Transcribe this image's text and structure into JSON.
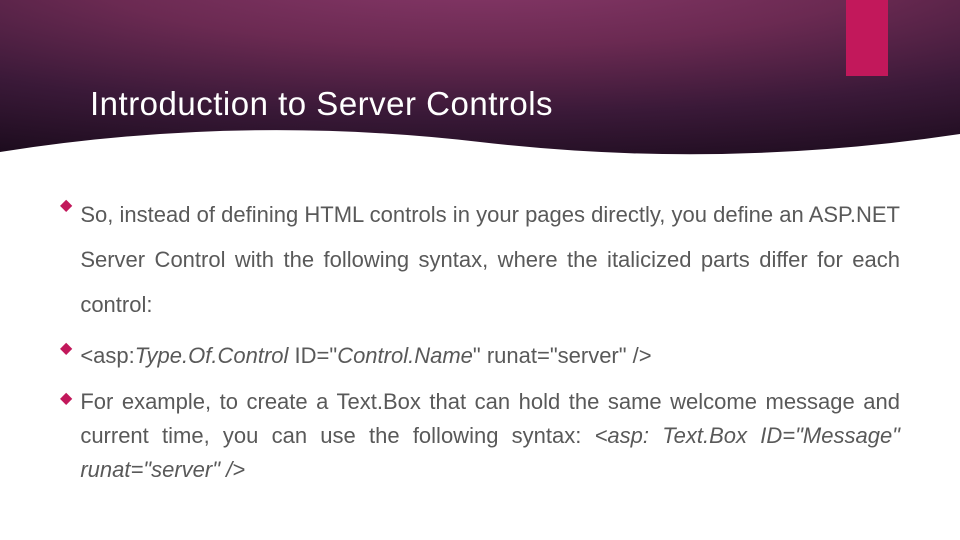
{
  "header": {
    "title": "Introduction to Server Controls"
  },
  "bullets": {
    "b1": {
      "text": "So, instead of defining HTML controls in your pages directly, you define an ASP.NET Server Control with the following syntax, where the italicized parts differ for each control:"
    },
    "b2": {
      "prefix": "<asp:",
      "italic1": "Type.Of.Control ",
      "mid1": "ID=\"",
      "italic2": "Control.Name",
      "mid2": "\" runat=\"server\" />"
    },
    "b3": {
      "lead": "For",
      "rest": " example, to create a Text.Box that can hold the same welcome message and current time, you can use the following syntax: ",
      "italic_code": "<asp: Text.Box ID=\"Message\" runat=\"server\" />"
    }
  }
}
